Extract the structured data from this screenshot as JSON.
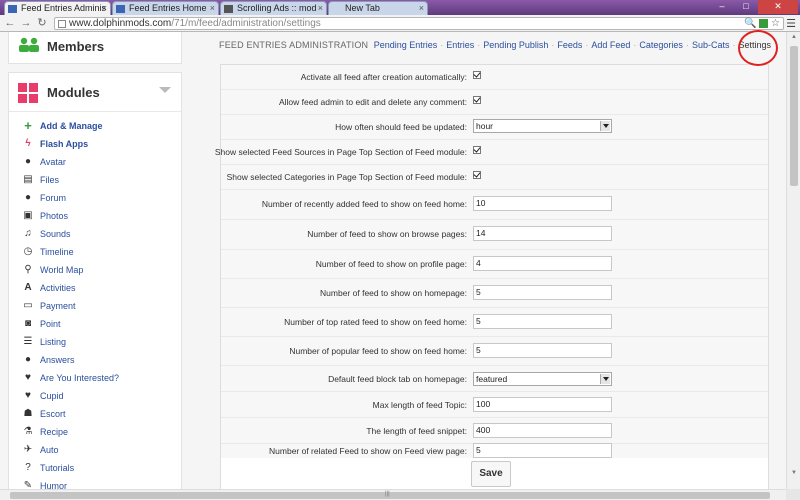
{
  "browser": {
    "tabs": [
      {
        "title": "Feed Entries Adminis",
        "active": true
      },
      {
        "title": "Feed Entries Home",
        "active": false
      },
      {
        "title": "Scrolling Ads :: mod",
        "active": false
      },
      {
        "title": "New Tab",
        "active": false
      }
    ],
    "url_host": "www.dolphinmods.com",
    "url_path": "/71/m/feed/administration/settings"
  },
  "sidebar": {
    "members_title": "Members",
    "modules_title": "Modules",
    "items": [
      {
        "label": "Add & Manage",
        "icon": "plus-icon",
        "bold": true
      },
      {
        "label": "Flash Apps",
        "icon": "lightning-icon",
        "bold": true
      },
      {
        "label": "Avatar",
        "icon": "avatar-icon",
        "bold": false
      },
      {
        "label": "Files",
        "icon": "file-icon",
        "bold": false
      },
      {
        "label": "Forum",
        "icon": "forum-icon",
        "bold": false
      },
      {
        "label": "Photos",
        "icon": "photo-icon",
        "bold": false
      },
      {
        "label": "Sounds",
        "icon": "music-icon",
        "bold": false
      },
      {
        "label": "Timeline",
        "icon": "clock-icon",
        "bold": false
      },
      {
        "label": "World Map",
        "icon": "map-pin-icon",
        "bold": false
      },
      {
        "label": "Activities",
        "icon": "activities-icon",
        "bold": false
      },
      {
        "label": "Payment",
        "icon": "card-icon",
        "bold": false
      },
      {
        "label": "Point",
        "icon": "point-icon",
        "bold": false
      },
      {
        "label": "Listing",
        "icon": "listing-icon",
        "bold": false
      },
      {
        "label": "Answers",
        "icon": "answers-icon",
        "bold": false
      },
      {
        "label": "Are You Interested?",
        "icon": "heart-icon",
        "bold": false
      },
      {
        "label": "Cupid",
        "icon": "heart-icon",
        "bold": false
      },
      {
        "label": "Escort",
        "icon": "escort-icon",
        "bold": false
      },
      {
        "label": "Recipe",
        "icon": "recipe-icon",
        "bold": false
      },
      {
        "label": "Auto",
        "icon": "car-icon",
        "bold": false
      },
      {
        "label": "Tutorials",
        "icon": "question-icon",
        "bold": false
      },
      {
        "label": "Humor",
        "icon": "pencil-icon",
        "bold": false
      }
    ]
  },
  "header": {
    "title": "FEED ENTRIES ADMINISTRATION",
    "tabs": [
      {
        "label": "Pending Entries",
        "current": false
      },
      {
        "label": "Entries",
        "current": false
      },
      {
        "label": "Pending Publish",
        "current": false
      },
      {
        "label": "Feeds",
        "current": false
      },
      {
        "label": "Add Feed",
        "current": false
      },
      {
        "label": "Categories",
        "current": false
      },
      {
        "label": "Sub-Cats",
        "current": false
      },
      {
        "label": "Settings",
        "current": true
      }
    ]
  },
  "settings": [
    {
      "label": "Activate all feed after creation automatically:",
      "type": "checkbox",
      "value": "checked"
    },
    {
      "label": "Allow feed admin to edit and delete any comment:",
      "type": "checkbox",
      "value": "checked"
    },
    {
      "label": "How often should feed be updated:",
      "type": "select",
      "value": "hour"
    },
    {
      "label": "Show selected Feed Sources in Page Top Section of Feed module:",
      "type": "checkbox",
      "value": "checked"
    },
    {
      "label": "Show selected Categories in Page Top Section of Feed module:",
      "type": "checkbox",
      "value": "checked"
    },
    {
      "label": "Number of recently added feed to show on feed home:",
      "type": "text",
      "value": "10"
    },
    {
      "label": "Number of feed to show on browse pages:",
      "type": "text",
      "value": "14"
    },
    {
      "label": "Number of feed to show on profile page:",
      "type": "text",
      "value": "4"
    },
    {
      "label": "Number of feed to show on homepage:",
      "type": "text",
      "value": "5"
    },
    {
      "label": "Number of top rated feed to show on feed home:",
      "type": "text",
      "value": "5"
    },
    {
      "label": "Number of popular feed to show on feed home:",
      "type": "text",
      "value": "5"
    },
    {
      "label": "Default feed block tab on homepage:",
      "type": "select",
      "value": "featured"
    },
    {
      "label": "Max length of feed Topic:",
      "type": "text",
      "value": "100"
    },
    {
      "label": "The length of feed snippet:",
      "type": "text",
      "value": "400"
    },
    {
      "label": "Number of related Feed to show on Feed view page:",
      "type": "text",
      "value": "5"
    }
  ],
  "save_label": "Save",
  "colors": {
    "link": "#2a4f9e",
    "modules_icon": "#e83c6a",
    "members_icon": "#3cad3c",
    "annotation": "#e02020"
  }
}
